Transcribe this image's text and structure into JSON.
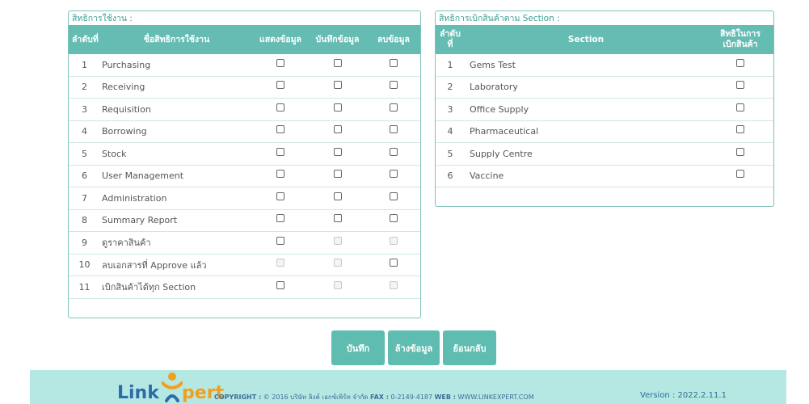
{
  "permissions": {
    "title": "สิทธิการใช้งาน :",
    "headers": {
      "no": "ลำดับที่",
      "name": "ชื่อสิทธิการใช้งาน",
      "view": "แสดงข้อมูล",
      "save": "บันทึกข้อมูล",
      "delete": "ลบข้อมูล"
    },
    "rows": [
      {
        "no": "1",
        "name": "Purchasing",
        "view": "enabled",
        "save": "enabled",
        "delete": "enabled"
      },
      {
        "no": "2",
        "name": "Receiving",
        "view": "enabled",
        "save": "enabled",
        "delete": "enabled"
      },
      {
        "no": "3",
        "name": "Requisition",
        "view": "enabled",
        "save": "enabled",
        "delete": "enabled"
      },
      {
        "no": "4",
        "name": "Borrowing",
        "view": "enabled",
        "save": "enabled",
        "delete": "enabled"
      },
      {
        "no": "5",
        "name": "Stock",
        "view": "enabled",
        "save": "enabled",
        "delete": "enabled"
      },
      {
        "no": "6",
        "name": "User Management",
        "view": "enabled",
        "save": "enabled",
        "delete": "enabled"
      },
      {
        "no": "7",
        "name": "Administration",
        "view": "enabled",
        "save": "enabled",
        "delete": "enabled"
      },
      {
        "no": "8",
        "name": "Summary Report",
        "view": "enabled",
        "save": "enabled",
        "delete": "enabled"
      },
      {
        "no": "9",
        "name": "ดูราคาสินค้า",
        "view": "enabled",
        "save": "disabled",
        "delete": "disabled"
      },
      {
        "no": "10",
        "name": "ลบเอกสารที่ Approve แล้ว",
        "view": "disabled",
        "save": "disabled",
        "delete": "enabled"
      },
      {
        "no": "11",
        "name": "เบิกสินค้าได้ทุก Section",
        "view": "enabled",
        "save": "disabled",
        "delete": "disabled"
      }
    ]
  },
  "sections": {
    "title": "สิทธิการเบิกสินค้าตาม Section :",
    "headers": {
      "no_line1": "ลำดับ",
      "no_line2": "ที่",
      "section": "Section",
      "right_line1": "สิทธิในการ",
      "right_line2": "เบิกสินค้า"
    },
    "rows": [
      {
        "no": "1",
        "name": "Gems Test"
      },
      {
        "no": "2",
        "name": "Laboratory"
      },
      {
        "no": "3",
        "name": "Office Supply"
      },
      {
        "no": "4",
        "name": "Pharmaceutical"
      },
      {
        "no": "5",
        "name": "Supply Centre"
      },
      {
        "no": "6",
        "name": "Vaccine"
      }
    ]
  },
  "buttons": {
    "save": "บันทึก",
    "clear": "ล้างข้อมูล",
    "back": "ย้อนกลับ"
  },
  "footer": {
    "logo_part1": "Link",
    "logo_part2": "pert",
    "copyright_label": "COPYRIGHT :",
    "copyright_text": "© 2016 บริษัท ลิงค์ เอกซ์เพิร์ท จำกัด",
    "fax_label": "FAX :",
    "fax": "0-2149-4187",
    "web_label": "WEB :",
    "web": "WWW.LINKEXPERT.COM",
    "version": "Version : 2022.2.11.1"
  },
  "colors": {
    "accent": "#64bcb2",
    "footer_bg": "#b5e8e3",
    "logo_blue": "#2e6ca8",
    "logo_orange": "#f0a020"
  }
}
